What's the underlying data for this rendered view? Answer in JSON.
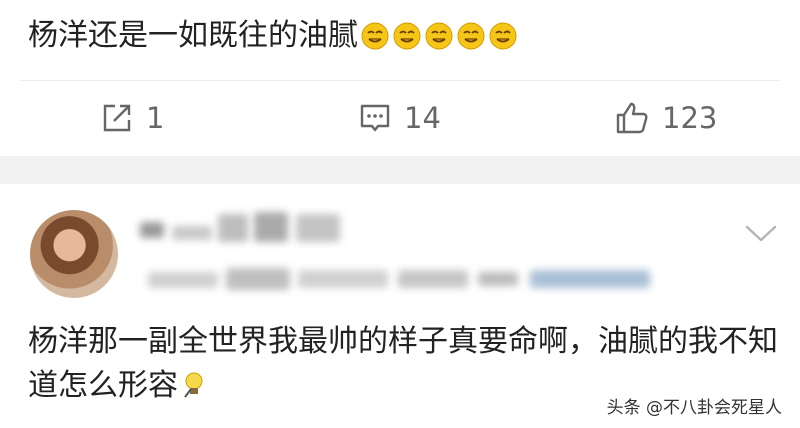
{
  "post": {
    "text": "杨洋还是一如既往的油腻",
    "emoji_icon": "smirk-face-icon",
    "emoji_count": 5
  },
  "actions": {
    "share": {
      "icon": "share-icon",
      "count": "1"
    },
    "comment": {
      "icon": "comment-icon",
      "count": "14"
    },
    "like": {
      "icon": "thumbs-up-icon",
      "count": "123"
    }
  },
  "comment": {
    "username_blurred": true,
    "meta_blurred": true,
    "text": "杨洋那一副全世界我最帅的样子真要命啊，油腻的我不知道怎么形容",
    "trailing_icon": "lightbulb-icon"
  },
  "watermark": "头条 @不八卦会死星人",
  "colors": {
    "text": "#222222",
    "action_gray": "#666666",
    "band": "#f2f2f2",
    "emoji_yellow": "#f5c518"
  }
}
